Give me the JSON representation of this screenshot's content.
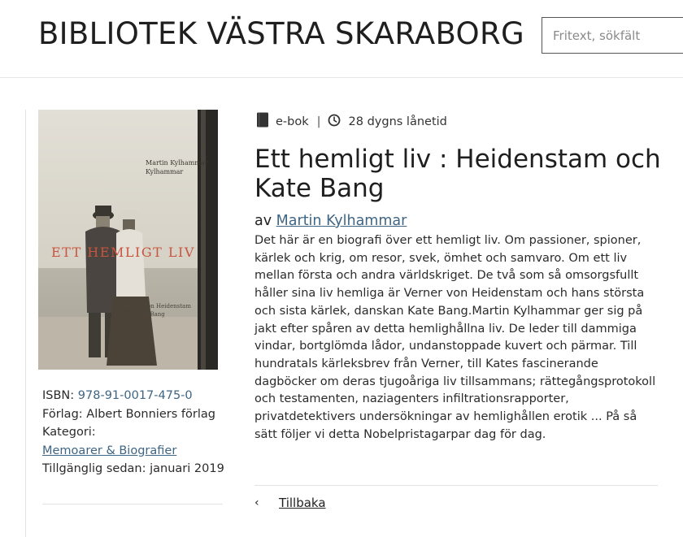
{
  "header": {
    "site_title": "BIBLIOTEK VÄSTRA SKARABORG",
    "search_placeholder": "Fritext, sökfält",
    "search_value": ""
  },
  "cover": {
    "title_text": "ETT HEMLIGT LIV",
    "author_text": "Martin Kylhammar",
    "subtitle_text": "Verner von Heidenstam och Kate Bang",
    "title_color": "#c8553d"
  },
  "meta": {
    "isbn_label": "ISBN:",
    "isbn_value": "978-91-0017-475-0",
    "publisher_label": "Förlag:",
    "publisher_value": "Albert Bonniers förlag",
    "category_label": "Kategori:",
    "category_link": "Memoarer & Biografier",
    "available_label": "Tillgänglig sedan:",
    "available_value": "januari 2019"
  },
  "format": {
    "icon": "book-icon",
    "type_label": "e-bok",
    "separator": "|",
    "loan_icon": "clock-icon",
    "loan_label": "28 dygns lånetid"
  },
  "book": {
    "title": "Ett hemligt liv : Heidenstam och Kate Bang",
    "author_prefix": "av",
    "author_name": "Martin Kylhammar",
    "description": "Det här är en biografi över ett hemligt liv. Om passioner, spioner, kärlek och krig, om resor, svek, ömhet och samvaro. Om ett liv mellan första och andra världskriget. De två som så omsorgsfullt håller sina liv hemliga är Verner von Heidenstam och hans största och sista kärlek, danskan Kate Bang.Martin Kylhammar ger sig på jakt efter spåren av detta hemlighållna liv. De leder till dammiga vindar, bortglömda lådor, undanstoppade kuvert och pärmar. Till hundratals kärleksbrev från Verner, till Kates fascinerande dagböcker om deras tjugoåriga liv tillsammans; rättegångsprotokoll och testamenten, naziagenters infiltrationsrapporter, privatdetektivers undersökningar av hemlighållen erotik ... På så sätt följer vi detta Nobelpristagarpar dag för dag."
  },
  "navigation": {
    "back_icon": "chevron-left-icon",
    "back_label": "Tillbaka"
  },
  "colors": {
    "link": "#3e6584",
    "text": "#222222",
    "rule": "#e3e3e3"
  }
}
